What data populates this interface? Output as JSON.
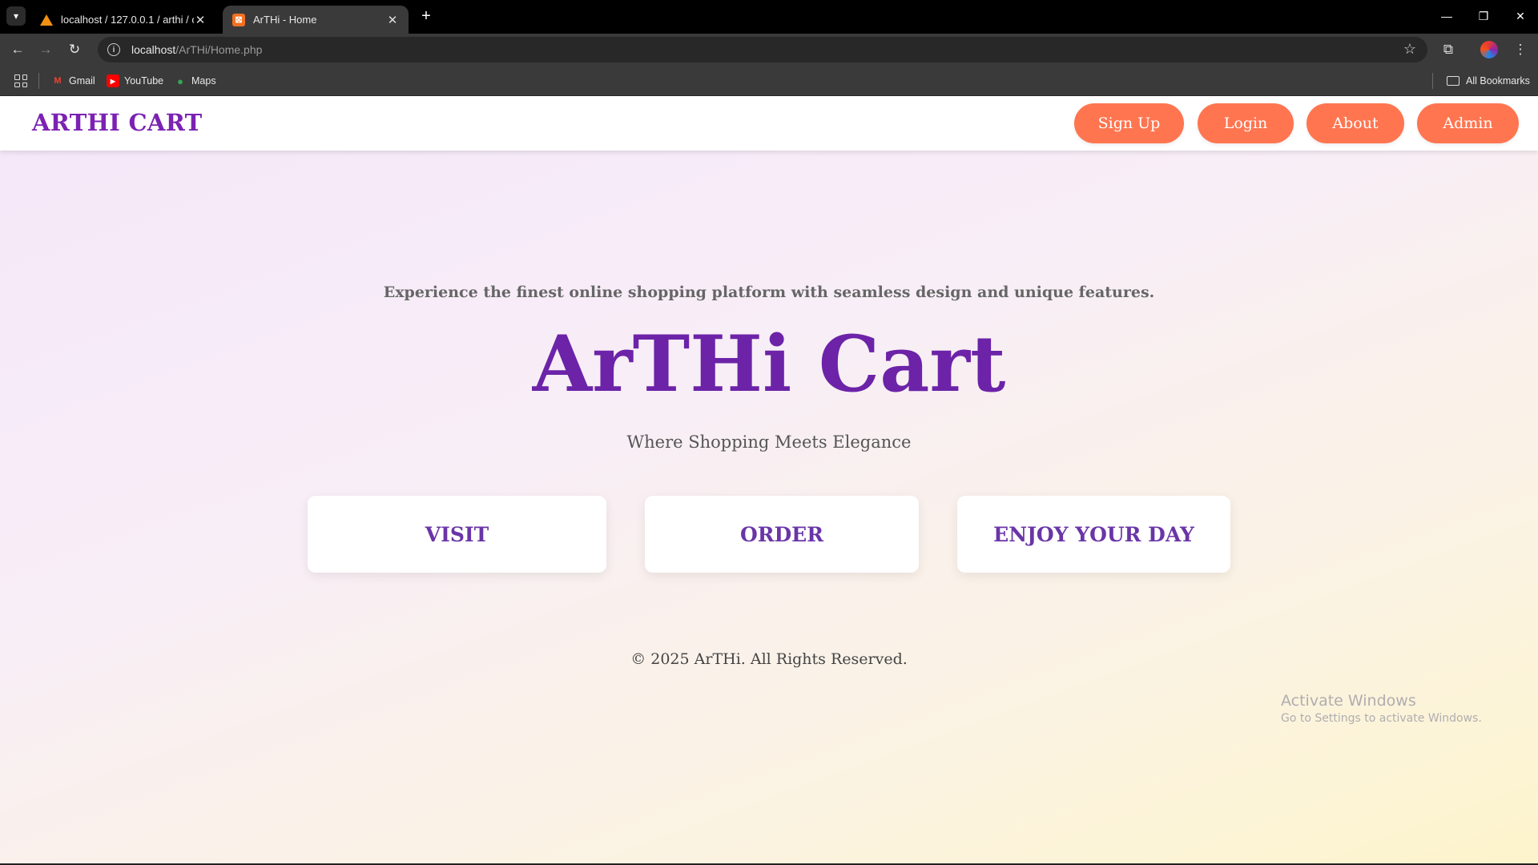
{
  "browser": {
    "tabs": [
      {
        "title": "localhost / 127.0.0.1 / arthi / cu",
        "favicon": "phpmyadmin-icon",
        "active": false
      },
      {
        "title": "ArTHi - Home",
        "favicon": "xampp-icon",
        "active": true
      }
    ],
    "new_tab": "+",
    "url_host": "localhost",
    "url_path": "/ArTHi/Home.php",
    "bookmarks": [
      {
        "label": "Gmail",
        "icon": "gmail-icon",
        "color": "#ea4335"
      },
      {
        "label": "YouTube",
        "icon": "youtube-icon",
        "color": "#ff0000"
      },
      {
        "label": "Maps",
        "icon": "maps-icon",
        "color": "#34a853"
      }
    ],
    "all_bookmarks": "All Bookmarks"
  },
  "site": {
    "brand": "ARTHI CART",
    "nav": [
      "Sign Up",
      "Login",
      "About",
      "Admin"
    ],
    "tagline": "Experience the finest online shopping platform with seamless design and unique features.",
    "hero_title": "ArTHi Cart",
    "subtitle": "Where Shopping Meets Elegance",
    "cards": [
      "VISIT",
      "ORDER",
      "ENJOY YOUR DAY"
    ],
    "copyright": "© 2025 ArTHi. All Rights Reserved."
  },
  "colors": {
    "brand": "#7b22b3",
    "hero": "#6c23a8",
    "nav_button": "#ff7550",
    "card_text": "#6a35a8"
  },
  "os": {
    "activate_title": "Activate Windows",
    "activate_text": "Go to Settings to activate Windows."
  }
}
